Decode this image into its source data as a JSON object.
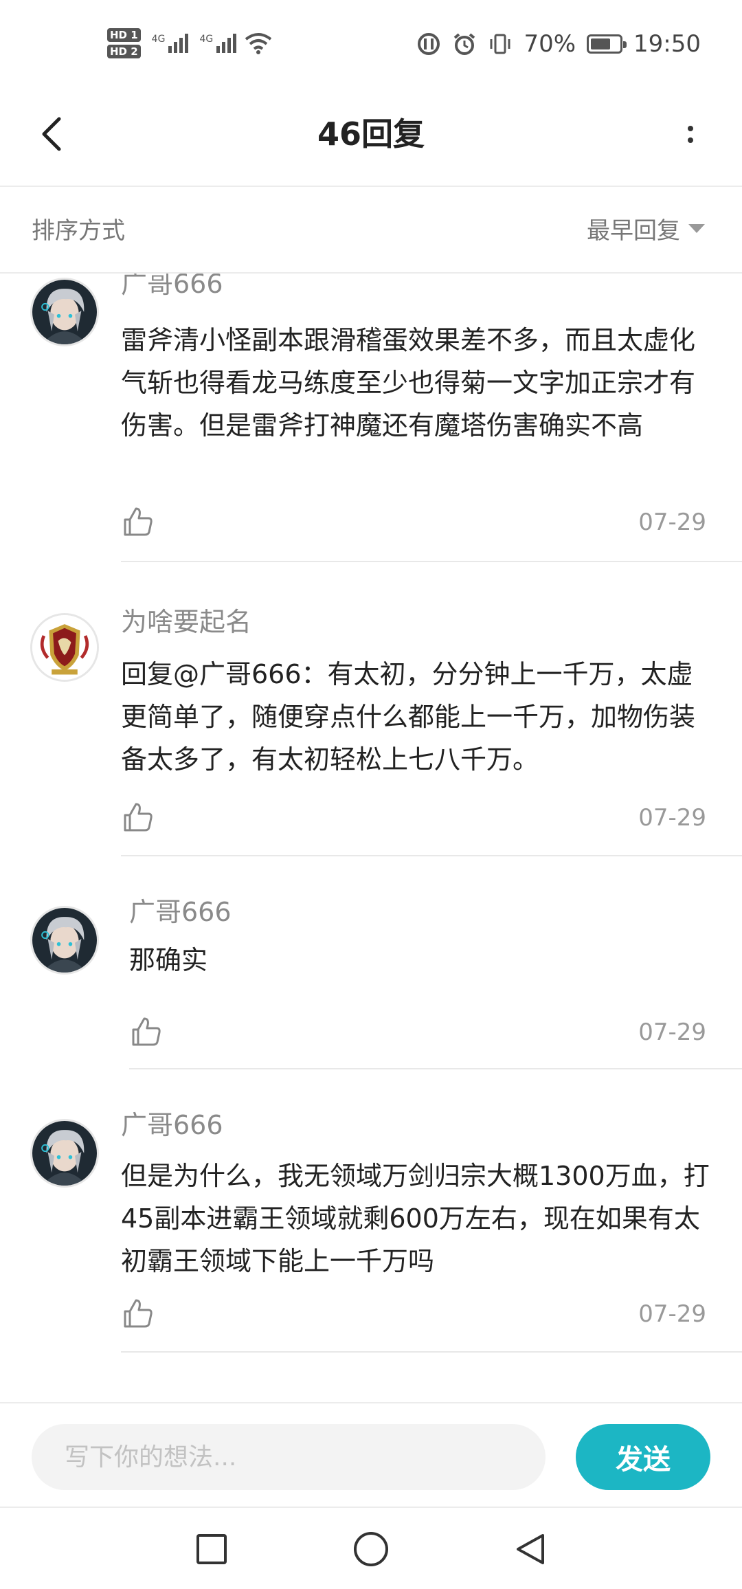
{
  "status_bar": {
    "hd_badges": [
      "HD 1",
      "HD 2"
    ],
    "network": "4G",
    "battery_percent": "70%",
    "battery_level": 0.7,
    "time": "19:50"
  },
  "header": {
    "title": "46回复",
    "back_icon": "chevron-left-icon",
    "more_icon": "more-vertical-icon"
  },
  "sort": {
    "label": "排序方式",
    "selected": "最早回复"
  },
  "comments": [
    {
      "username": "广哥666",
      "avatar": "anime-silver-hair-avatar",
      "text": "雷斧清小怪副本跟滑稽蛋效果差不多，而且太虚化气斩也得看龙马练度至少也得菊一文字加正宗才有伤害。但是雷斧打神魔还有魔塔伤害确实不高",
      "date": "07-29"
    },
    {
      "username": "为啥要起名",
      "avatar": "crest-avatar",
      "text": "回复@广哥666：有太初，分分钟上一千万，太虚更简单了，随便穿点什么都能上一千万，加物伤装备太多了，有太初轻松上七八千万。",
      "date": "07-29"
    },
    {
      "username": "广哥666",
      "avatar": "anime-silver-hair-avatar",
      "text": "那确实",
      "date": "07-29"
    },
    {
      "username": "广哥666",
      "avatar": "anime-silver-hair-avatar",
      "text": "但是为什么，我无领域万剑归宗大概1300万血，打45副本进霸王领域就剩600万左右，现在如果有太初霸王领域下能上一千万吗",
      "date": "07-29"
    }
  ],
  "input_bar": {
    "placeholder": "写下你的想法...",
    "send_label": "发送"
  },
  "colors": {
    "accent": "#1cb6c4",
    "username": "#8a8a8a",
    "date": "#999999"
  }
}
